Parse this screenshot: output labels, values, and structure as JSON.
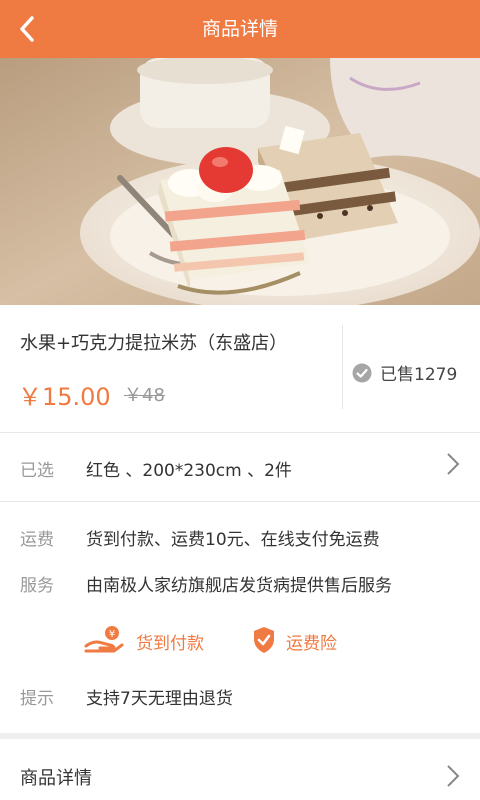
{
  "header": {
    "title": "商品详情"
  },
  "product": {
    "name": "水果+巧克力提拉米苏（东盛店）",
    "price": "￥15.00",
    "original_price": "￥48",
    "sold": "已售1279"
  },
  "selection": {
    "label": "已选",
    "value": "红色 、200*230cm 、2件"
  },
  "shipping": {
    "label": "运费",
    "value": "货到付款、运费10元、在线支付免运费"
  },
  "service": {
    "label": "服务",
    "value": "由南极人家纺旗舰店发货病提供售后服务"
  },
  "badges": [
    {
      "icon": "cash-on-delivery-icon",
      "label": "货到付款"
    },
    {
      "icon": "shipping-insurance-shield-icon",
      "label": "运费险"
    }
  ],
  "tips": {
    "label": "提示",
    "value": "支持7天无理由退货"
  },
  "details": {
    "label": "商品详情"
  },
  "colors": {
    "accent": "#ef7a42"
  }
}
